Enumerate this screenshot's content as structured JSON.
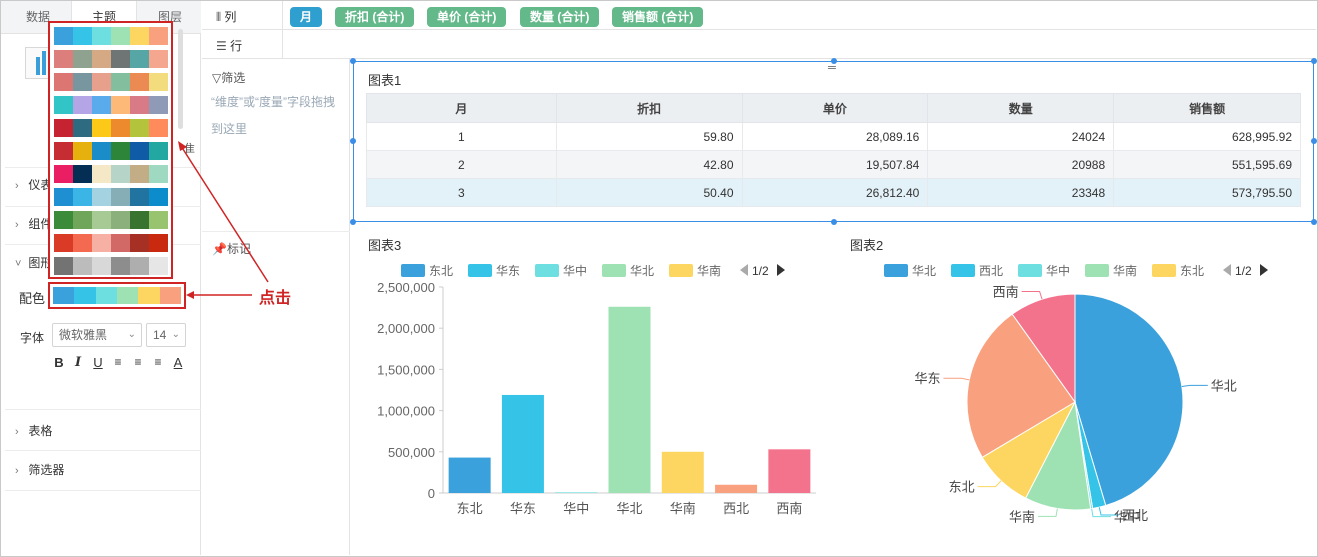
{
  "left_tabs": [
    "数据",
    "主题",
    "图层"
  ],
  "left_sections": {
    "sec1": "仪表",
    "sec2": "组件",
    "sec3": "图形",
    "peise_label": "配色",
    "font_label": "字体",
    "font_family": "微软雅黑",
    "font_size": "14",
    "table_sec": "表格",
    "filter_sec": "筛选器",
    "partial_char": "隹"
  },
  "palettes": [
    [
      "#3ba1dc",
      "#35c3e8",
      "#6ddfe0",
      "#9ee2b4",
      "#fdd661",
      "#f9a07e"
    ],
    [
      "#dc7e7c",
      "#8ea28f",
      "#d4a983",
      "#6f7575",
      "#56a6a5",
      "#f4a68f"
    ],
    [
      "#dc7672",
      "#7796a0",
      "#e6a08b",
      "#83bf9e",
      "#ec8a53",
      "#f2dc7d"
    ],
    [
      "#32c5c8",
      "#b4a6e6",
      "#5aabec",
      "#fdb977",
      "#d97b87",
      "#8f9bb6"
    ],
    [
      "#c52332",
      "#2f6b80",
      "#fcc919",
      "#ec8a2d",
      "#b3c33c",
      "#ff8a5b"
    ],
    [
      "#c52d32",
      "#e7b10d",
      "#1a8dc8",
      "#2d8539",
      "#105ba6",
      "#22a7a1"
    ],
    [
      "#e91e63",
      "#052e55",
      "#f5e8c6",
      "#b6d4c8",
      "#c3ad86",
      "#9fd9c1"
    ],
    [
      "#1e90d2",
      "#3ab5e6",
      "#a4d2e0",
      "#86aeb7",
      "#2174a0",
      "#0d8ccc"
    ],
    [
      "#3b8b3a",
      "#6fa659",
      "#a7c994",
      "#8bb07c",
      "#38742f",
      "#98c36f"
    ],
    [
      "#d93b26",
      "#f46a50",
      "#f6b1a4",
      "#d36967",
      "#a73024",
      "#c8290f"
    ],
    [
      "#737373",
      "#bcbcbc",
      "#d8d8d8",
      "#8d8d8d",
      "#aeaeae",
      "#e6e6e6"
    ]
  ],
  "annotation": "点击",
  "shelves": {
    "col_label": "列",
    "row_label": "行",
    "pills": [
      {
        "label": "月",
        "color": "#2e9fcf"
      },
      {
        "label": "折扣 (合计)",
        "color": "#63b98a"
      },
      {
        "label": "单价 (合计)",
        "color": "#63b98a"
      },
      {
        "label": "数量 (合计)",
        "color": "#63b98a"
      },
      {
        "label": "销售额 (合计)",
        "color": "#63b98a"
      }
    ],
    "filter_label": "筛选",
    "filter_hint": "“维度”或“度量”字段拖拽到这里",
    "mark_label": "标记"
  },
  "table": {
    "title": "图表1",
    "headers": [
      "月",
      "折扣",
      "单价",
      "数量",
      "销售额"
    ],
    "rows": [
      [
        "1",
        "59.80",
        "28,089.16",
        "24024",
        "628,995.92"
      ],
      [
        "2",
        "42.80",
        "19,507.84",
        "20988",
        "551,595.69"
      ],
      [
        "3",
        "50.40",
        "26,812.40",
        "23348",
        "573,795.50"
      ]
    ]
  },
  "colors": {
    "accent": "#3a8ee6",
    "highlight_red": "#d02424"
  },
  "chart_data": [
    {
      "type": "bar",
      "title": "图表3",
      "categories": [
        "东北",
        "华东",
        "华中",
        "华北",
        "华南",
        "西北",
        "西南"
      ],
      "values": [
        430000,
        1190000,
        8000,
        2260000,
        500000,
        100000,
        530000
      ],
      "colors": [
        "#3ba1dc",
        "#35c3e8",
        "#6ddfe0",
        "#9ee2b4",
        "#fdd661",
        "#f9a07e",
        "#f4738c"
      ],
      "ylim": [
        0,
        2500000
      ],
      "yticks": [
        "2,500,000",
        "2,000,000",
        "1,500,000",
        "1,000,000",
        "500,000",
        "0"
      ],
      "legend": [
        "东北",
        "华东",
        "华中",
        "华北",
        "华南"
      ],
      "legend_page": "1/2"
    },
    {
      "type": "pie",
      "title": "图表2",
      "slices": [
        {
          "label": "华北",
          "value": 46,
          "color": "#3ba1dc"
        },
        {
          "label": "西北",
          "value": 2,
          "color": "#35c3e8"
        },
        {
          "label": "华中",
          "value": 0.3,
          "color": "#6ddfe0"
        },
        {
          "label": "华南",
          "value": 10,
          "color": "#9ee2b4"
        },
        {
          "label": "东北",
          "value": 9,
          "color": "#fdd661"
        },
        {
          "label": "华东",
          "value": 24,
          "color": "#f9a07e"
        },
        {
          "label": "西南",
          "value": 10,
          "color": "#f4738c"
        }
      ],
      "legend": [
        "华北",
        "西北",
        "华中",
        "华南",
        "东北"
      ],
      "legend_page": "1/2"
    }
  ]
}
